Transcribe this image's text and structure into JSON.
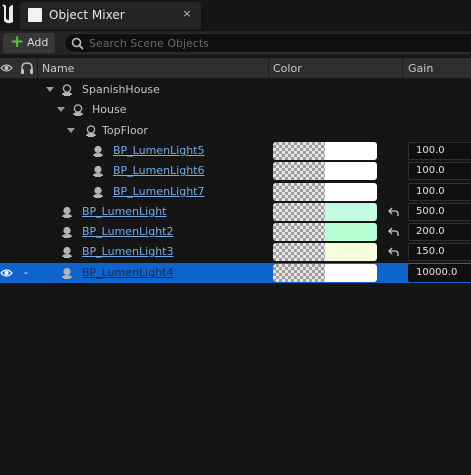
{
  "window": {
    "tab_title": "Object Mixer",
    "close_glyph": "×"
  },
  "toolbar": {
    "add_label": "Add",
    "add_icon": "plus-icon",
    "search_placeholder": "Search Scene Objects"
  },
  "header": {
    "name_col": "Name",
    "color_col": "Color",
    "gain_col": "Gain"
  },
  "colors": {
    "accent_selected": "#0e64cc",
    "link": "#76a9e6",
    "add_plus": "#5fbf3b"
  },
  "rows": [
    {
      "name": "SpanishHouse",
      "kind": "folder",
      "level": 1,
      "expanded": true
    },
    {
      "name": "House",
      "kind": "folder",
      "level": 2,
      "expanded": true
    },
    {
      "name": "TopFloor",
      "kind": "folder",
      "level": 3,
      "expanded": true
    },
    {
      "name": "BP_LumenLight5",
      "kind": "light",
      "level": 4,
      "color": "#ffffff",
      "gain": "100.0",
      "reset": false
    },
    {
      "name": "BP_LumenLight6",
      "kind": "light",
      "level": 4,
      "color": "#ffffff",
      "gain": "100.0",
      "reset": false
    },
    {
      "name": "BP_LumenLight7",
      "kind": "light",
      "level": 4,
      "color": "#ffffff",
      "gain": "100.0",
      "reset": false
    },
    {
      "name": "BP_LumenLight",
      "kind": "light",
      "level": 1,
      "color": "#c2fbe0",
      "gain": "500.0",
      "reset": true
    },
    {
      "name": "BP_LumenLight2",
      "kind": "light",
      "level": 1,
      "color": "#b6fed2",
      "gain": "200.0",
      "reset": true
    },
    {
      "name": "BP_LumenLight3",
      "kind": "light",
      "level": 1,
      "color": "#f3ffdb",
      "gain": "150.0",
      "reset": true
    },
    {
      "name": "BP_LumenLight4",
      "kind": "light",
      "level": 1,
      "color": "#ffffff",
      "gain": "10000.0",
      "reset": false,
      "selected": true,
      "selected_marker": "-"
    }
  ]
}
